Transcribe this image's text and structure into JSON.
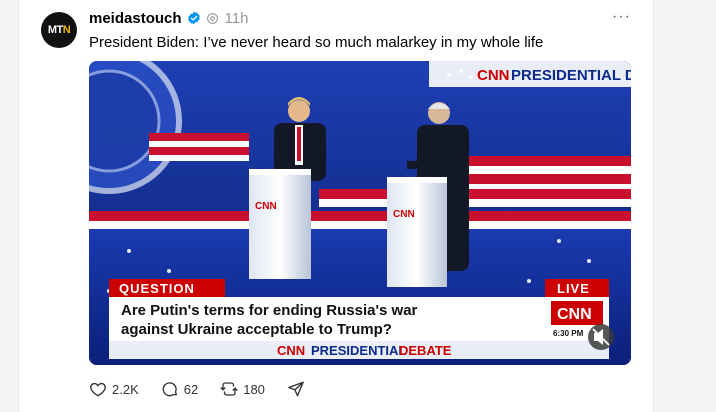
{
  "post": {
    "avatar_text_a": "MT",
    "avatar_text_b": "N",
    "username": "meidastouch",
    "time": "11h",
    "text": "President Biden: I’ve never heard so much malarkey in my whole life",
    "more": "···"
  },
  "media": {
    "backdrop_logo": "CNN",
    "backdrop_title": "PRESIDENTIAL DEBATE",
    "lower_third_tag": "QUESTION",
    "live_badge": "LIVE",
    "question_line1": "Are Putin's terms for ending Russia's war",
    "question_line2": "against Ukraine acceptable to Trump?",
    "clock": "6:30 PM",
    "bottom_logo": "CNN",
    "bottom_title_a": "PRESIDENTIAL",
    "bottom_title_b": "DEBATE"
  },
  "actions": {
    "likes": "2.2K",
    "comments": "62",
    "reposts": "180"
  },
  "colors": {
    "cnn_red": "#cc0000",
    "stage_blue": "#0c2a8c",
    "card": "#ffffff"
  }
}
